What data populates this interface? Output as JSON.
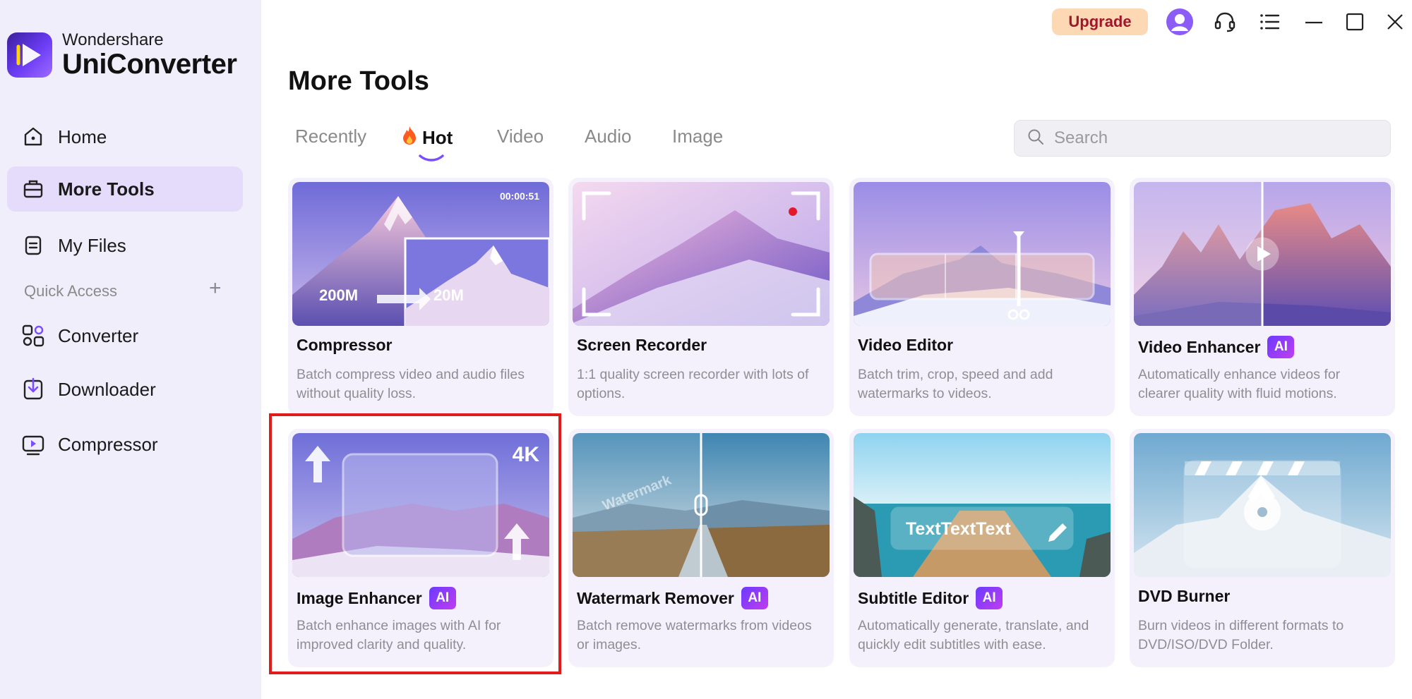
{
  "app": {
    "brand_sub": "Wondershare",
    "brand_main": "UniConverter"
  },
  "sidebar": {
    "nav": [
      {
        "label": "Home",
        "icon": "home-icon",
        "active": false
      },
      {
        "label": "More Tools",
        "icon": "toolbox-icon",
        "active": true
      },
      {
        "label": "My Files",
        "icon": "file-icon",
        "active": false
      }
    ],
    "quick_access_title": "Quick Access",
    "quick_access_add": "+",
    "quick_access": [
      {
        "label": "Converter",
        "icon": "converter-icon"
      },
      {
        "label": "Downloader",
        "icon": "downloader-icon"
      },
      {
        "label": "Compressor",
        "icon": "compressor-icon"
      }
    ]
  },
  "topbar": {
    "upgrade_label": "Upgrade",
    "icons": [
      "avatar-icon",
      "headset-icon",
      "menu-list-icon",
      "minimize-icon",
      "maximize-icon",
      "close-icon"
    ]
  },
  "main": {
    "title": "More Tools",
    "tabs": [
      {
        "label": "Recently",
        "active": false
      },
      {
        "label": "Hot",
        "active": true,
        "icon": "fire-icon"
      },
      {
        "label": "Video",
        "active": false
      },
      {
        "label": "Audio",
        "active": false
      },
      {
        "label": "Image",
        "active": false
      }
    ],
    "search": {
      "placeholder": "Search",
      "value": ""
    },
    "cards": [
      {
        "title": "Compressor",
        "ai": false,
        "desc": "Batch compress video and audio files without quality loss.",
        "overlay": {
          "time": "00:00:51",
          "from": "200M",
          "to": "20M"
        }
      },
      {
        "title": "Screen Recorder",
        "ai": false,
        "desc": "1:1 quality screen recorder with lots of options."
      },
      {
        "title": "Video Editor",
        "ai": false,
        "desc": "Batch trim, crop, speed and add watermarks to videos."
      },
      {
        "title": "Video Enhancer",
        "ai": true,
        "desc": "Automatically enhance videos for clearer quality with fluid motions."
      },
      {
        "title": "Image Enhancer",
        "ai": true,
        "desc": "Batch enhance images with AI for improved clarity and quality.",
        "overlay": {
          "res": "4K"
        }
      },
      {
        "title": "Watermark Remover",
        "ai": true,
        "desc": "Batch remove watermarks from videos or images.",
        "overlay": {
          "wm": "Watermark"
        }
      },
      {
        "title": "Subtitle Editor",
        "ai": true,
        "desc": "Automatically generate, translate, and quickly edit subtitles with ease.",
        "overlay": {
          "sample": "TextTextText"
        }
      },
      {
        "title": "DVD Burner",
        "ai": false,
        "desc": "Burn videos in different formats to DVD/ISO/DVD Folder."
      }
    ],
    "ai_badge": "AI"
  },
  "colors": {
    "accent": "#7a4dff",
    "highlight": "#e01b1b",
    "upgrade_bg": "#fcd9b4",
    "upgrade_text": "#a0162b"
  }
}
